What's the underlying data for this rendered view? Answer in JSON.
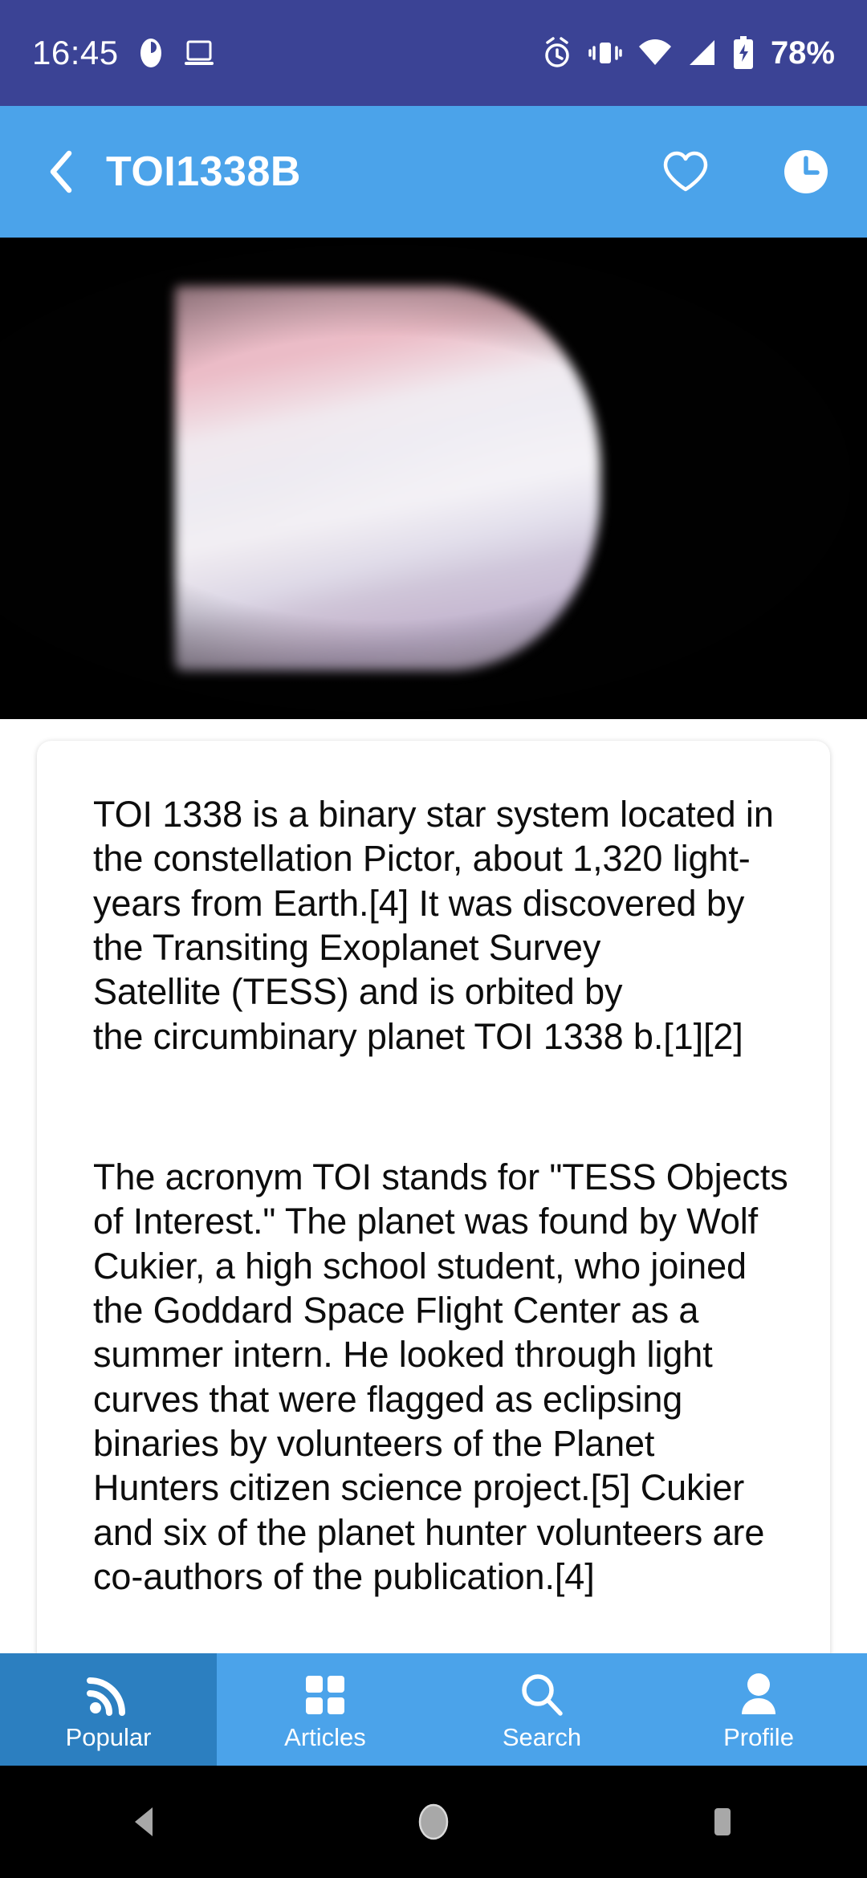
{
  "status_bar": {
    "time": "16:45",
    "battery_percent": "78%",
    "icons": [
      "headset-icon",
      "laptop-icon",
      "alarm-icon",
      "vibrate-icon",
      "wifi-icon",
      "signal-icon",
      "battery-charging-icon"
    ],
    "background_color": "#3b4395"
  },
  "app_bar": {
    "title": "TOI1338B",
    "back_icon": "chevron-left-icon",
    "favorite_icon": "heart-outline-icon",
    "history_icon": "clock-icon",
    "background_color": "#4ba3ea"
  },
  "hero": {
    "alt": "exoplanet-banded-atmosphere-photo",
    "background_color": "#010101"
  },
  "article": {
    "paragraphs": [
      "TOI 1338 is a binary star system located in\nthe constellation Pictor, about 1,320 light-\nyears from Earth.[4] It was discovered by\nthe Transiting Exoplanet Survey\nSatellite (TESS) and is orbited by\nthe circumbinary planet TOI 1338 b.[1][2]",
      "The acronym TOI stands for \"TESS Objects of Interest.\" The planet was found by Wolf Cukier, a high school student, who joined the Goddard Space Flight Center as a summer intern. He looked through light curves that were flagged as eclipsing binaries by volunteers of the Planet Hunters citizen science project.[5] Cukier and six of the planet hunter volunteers are co-authors of the publication.[4]"
    ]
  },
  "bottom_nav": {
    "active_color": "#2c7fc0",
    "background_color": "#4ba3ea",
    "items": [
      {
        "label": "Popular",
        "icon": "rss-icon",
        "active": true
      },
      {
        "label": "Articles",
        "icon": "grid-icon",
        "active": false
      },
      {
        "label": "Search",
        "icon": "search-icon",
        "active": false
      },
      {
        "label": "Profile",
        "icon": "person-icon",
        "active": false
      }
    ]
  },
  "android_nav": {
    "back": "back-triangle-icon",
    "home": "home-circle-icon",
    "recents": "recents-square-icon"
  }
}
